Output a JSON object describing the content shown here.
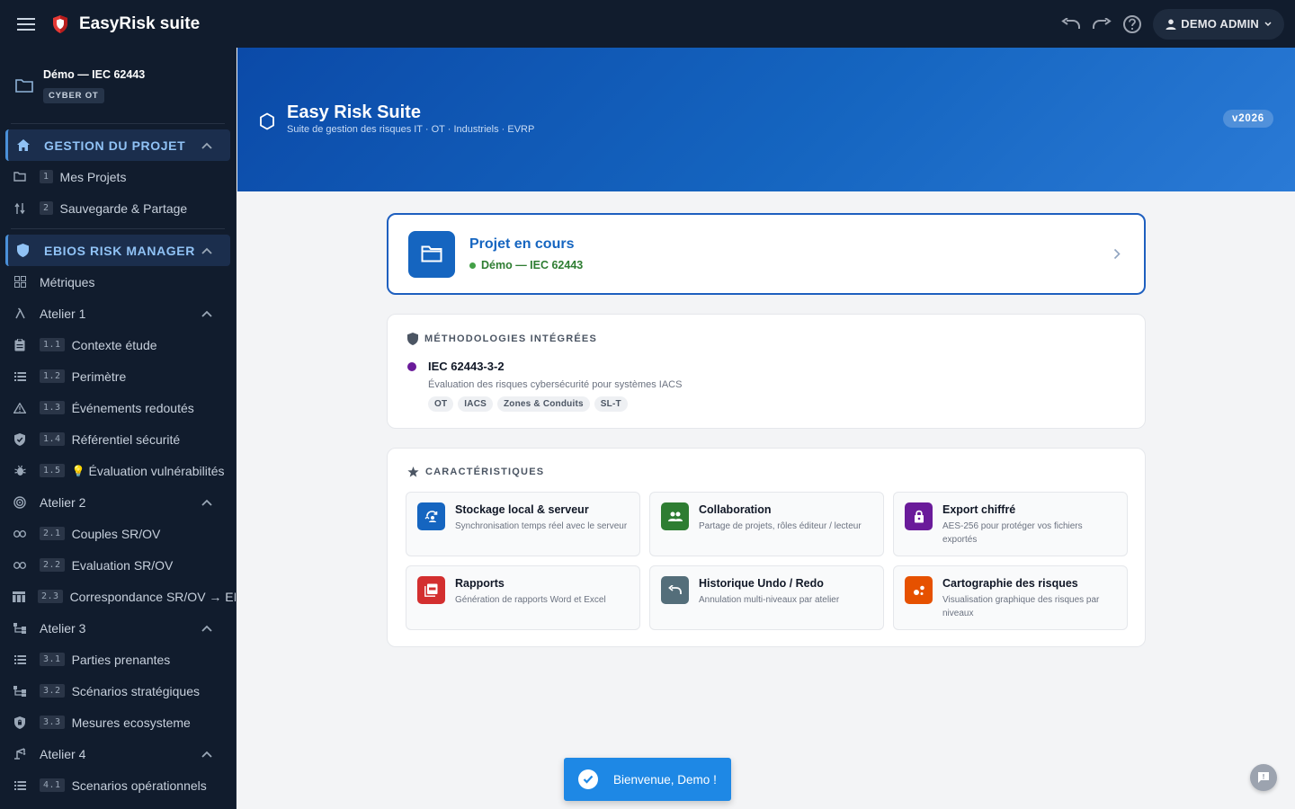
{
  "app": {
    "title": "EasyRisk suite"
  },
  "user": {
    "name": "DEMO ADMIN"
  },
  "sidebar": {
    "project": {
      "name": "Démo — IEC 62443",
      "badge": "CYBER OT"
    },
    "sections": [
      {
        "title": "GESTION DU PROJET",
        "items": [
          {
            "num": "1",
            "label": "Mes Projets",
            "icon": "folder-icon"
          },
          {
            "num": "2",
            "label": "Sauvegarde & Partage",
            "icon": "swap-vert-icon"
          }
        ]
      },
      {
        "title": "EBIOS RISK MANAGER",
        "items": [
          {
            "label": "Métriques",
            "icon": "grid-icon"
          },
          {
            "label": "Atelier 1",
            "icon": "lambda-icon"
          },
          {
            "num": "1.1",
            "label": "Contexte étude",
            "icon": "clipboard-icon"
          },
          {
            "num": "1.2",
            "label": "Perimètre",
            "icon": "list-icon"
          },
          {
            "num": "1.3",
            "label": "Événements redoutés",
            "icon": "warning-icon"
          },
          {
            "num": "1.4",
            "label": "Référentiel sécurité",
            "icon": "shield-check-icon"
          },
          {
            "num": "1.5",
            "label": "Évaluation vulnérabilités",
            "prefix": "💡",
            "icon": "bug-icon"
          },
          {
            "label": "Atelier 2",
            "icon": "target-icon"
          },
          {
            "num": "2.1",
            "label": "Couples SR/OV",
            "icon": "link-icon"
          },
          {
            "num": "2.2",
            "label": "Evaluation SR/OV",
            "icon": "link-icon"
          },
          {
            "num": "2.3",
            "label": "Correspondance SR/OV → EI",
            "icon": "table-icon"
          },
          {
            "label": "Atelier 3",
            "icon": "hierarchy-icon"
          },
          {
            "num": "3.1",
            "label": "Parties prenantes",
            "icon": "list-icon"
          },
          {
            "num": "3.2",
            "label": "Scénarios stratégiques",
            "icon": "hierarchy-icon"
          },
          {
            "num": "3.3",
            "label": "Mesures ecosysteme",
            "icon": "shield-lock-icon"
          },
          {
            "label": "Atelier 4",
            "icon": "crane-icon"
          },
          {
            "num": "4.1",
            "label": "Scenarios opérationnels",
            "icon": "list-icon"
          }
        ]
      }
    ]
  },
  "hero": {
    "title": "Easy Risk Suite",
    "subtitle": "Suite de gestion des risques IT · OT · Industriels · EVRP",
    "version": "v2026"
  },
  "current_project": {
    "title": "Projet en cours",
    "name": "Démo — IEC 62443"
  },
  "methodologies": {
    "heading": "MÉTHODOLOGIES INTÉGRÉES",
    "items": [
      {
        "name": "IEC 62443-3-2",
        "description": "Évaluation des risques cybersécurité pour systèmes IACS",
        "tags": [
          "OT",
          "IACS",
          "Zones & Conduits",
          "SL-T"
        ],
        "color": "#6a1b9a"
      }
    ]
  },
  "features": {
    "heading": "CARACTÉRISTIQUES",
    "items": [
      {
        "title": "Stockage local & serveur",
        "desc": "Synchronisation temps réel avec le serveur",
        "icon": "sync-icon",
        "color": "#1565c0"
      },
      {
        "title": "Collaboration",
        "desc": "Partage de projets, rôles éditeur / lecteur",
        "icon": "group-icon",
        "color": "#2e7d32"
      },
      {
        "title": "Export chiffré",
        "desc": "AES-256 pour protéger vos fichiers exportés",
        "icon": "lock-icon",
        "color": "#6a1b9a"
      },
      {
        "title": "Rapports",
        "desc": "Génération de rapports Word et Excel",
        "icon": "pdf-icon",
        "color": "#d32f2f"
      },
      {
        "title": "Historique Undo / Redo",
        "desc": "Annulation multi-niveaux par atelier",
        "icon": "undo-icon",
        "color": "#546e7a"
      },
      {
        "title": "Cartographie des risques",
        "desc": "Visualisation graphique des risques par niveaux",
        "icon": "bubble-chart-icon",
        "color": "#e65100"
      }
    ]
  },
  "toast": {
    "message": "Bienvenue, Demo !"
  }
}
